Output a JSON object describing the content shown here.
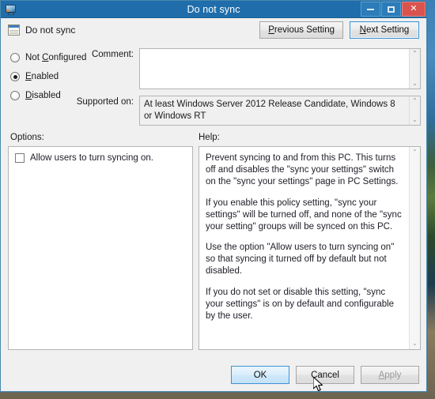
{
  "window": {
    "title": "Do not sync",
    "icon": "computer-monitor-icon",
    "caption": {
      "minimize": "minimize-icon",
      "maximize": "maximize-icon",
      "close": "✕"
    }
  },
  "header": {
    "policy_icon": "policy-setting-icon",
    "policy_name": "Do not sync",
    "previous_setting": {
      "pre": "P",
      "accel": "",
      "rest": "revious Setting",
      "label": "Previous Setting"
    },
    "next_setting": {
      "label": "Next Setting"
    }
  },
  "state": {
    "options": [
      {
        "label": "Not Configured",
        "accel": "C",
        "selected": false
      },
      {
        "label": "Enabled",
        "accel": "E",
        "selected": true
      },
      {
        "label": "Disabled",
        "accel": "D",
        "selected": false
      }
    ],
    "not_configured_label": "Not Configured",
    "enabled_label": "Enabled",
    "disabled_label": "Disabled"
  },
  "comment": {
    "label": "Comment:",
    "value": "",
    "placeholder": ""
  },
  "supported_on": {
    "label": "Supported on:",
    "value": "At least Windows Server 2012 Release Candidate, Windows 8 or Windows RT"
  },
  "options_pane": {
    "label": "Options:",
    "checkbox": {
      "label": "Allow users to turn syncing on.",
      "checked": false
    }
  },
  "help_pane": {
    "label": "Help:",
    "paragraphs": [
      "Prevent syncing to and from this PC.  This turns off and disables the \"sync your settings\" switch on the \"sync your settings\" page in PC Settings.",
      "If you enable this policy setting, \"sync your settings\" will be turned off, and none of the \"sync your setting\" groups will be synced on this PC.",
      "Use the option \"Allow users to turn syncing on\" so that syncing it turned off by default but not disabled.",
      "If you do not set or disable this setting, \"sync your settings\" is on by default and configurable by the user."
    ],
    "p0": "Prevent syncing to and from this PC.  This turns off and disables the \"sync your settings\" switch on the \"sync your settings\" page in PC Settings.",
    "p1": "If you enable this policy setting, \"sync your settings\" will be turned off, and none of the \"sync your setting\" groups will be synced on this PC.",
    "p2": "Use the option \"Allow users to turn syncing on\" so that syncing it turned off by default but not disabled.",
    "p3": "If you do not set or disable this setting, \"sync your settings\" is on by default and configurable by the user."
  },
  "footer": {
    "ok": "OK",
    "cancel": "Cancel",
    "apply": "Apply",
    "apply_enabled": false
  },
  "scrollbar": {
    "up": "⌃",
    "down": "⌄"
  },
  "colors": {
    "titlebar": "#1f6eab",
    "close": "#d9534f",
    "focus_border": "#3c93d4",
    "dialog_bg": "#f0f0f0",
    "disabled_text": "#9a9a9a"
  }
}
